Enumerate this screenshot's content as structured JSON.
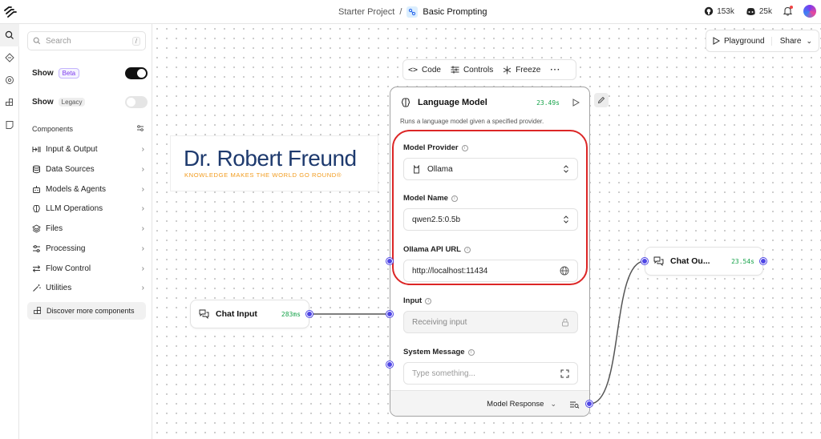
{
  "topbar": {
    "project": "Starter Project",
    "separator": "/",
    "flow_name": "Basic Prompting",
    "github_count": "153k",
    "discord_count": "25k"
  },
  "sidebar": {
    "search_placeholder": "Search",
    "search_shortcut": "/",
    "show_beta_label": "Show",
    "beta_badge": "Beta",
    "show_legacy_label": "Show",
    "legacy_badge": "Legacy",
    "components_heading": "Components",
    "categories": [
      {
        "label": "Input & Output",
        "icon": "input-output-icon"
      },
      {
        "label": "Data Sources",
        "icon": "database-icon"
      },
      {
        "label": "Models & Agents",
        "icon": "bot-icon"
      },
      {
        "label": "LLM Operations",
        "icon": "brain-icon"
      },
      {
        "label": "Files",
        "icon": "layers-icon"
      },
      {
        "label": "Processing",
        "icon": "sliders-icon"
      },
      {
        "label": "Flow Control",
        "icon": "arrows-icon"
      },
      {
        "label": "Utilities",
        "icon": "wand-icon"
      }
    ],
    "discover_label": "Discover more components"
  },
  "canvas": {
    "playground_label": "Playground",
    "share_label": "Share",
    "logo": {
      "name": "Dr. Robert Freund",
      "tagline": "KNOWLEDGE MAKES THE WORLD GO ROUND®"
    },
    "node_toolbar": {
      "code": "Code",
      "controls": "Controls",
      "freeze": "Freeze",
      "more": "···"
    },
    "language_model": {
      "title": "Language Model",
      "time": "23.49s",
      "description": "Runs a language model given a specified provider.",
      "provider_label": "Model Provider",
      "provider_value": "Ollama",
      "model_label": "Model Name",
      "model_value": "qwen2.5:0.5b",
      "url_label": "Ollama API URL",
      "url_value": "http://localhost:11434",
      "input_label": "Input",
      "input_placeholder": "Receiving input",
      "system_label": "System Message",
      "system_placeholder": "Type something...",
      "output_label": "Model Response"
    },
    "chat_input": {
      "label": "Chat Input",
      "time": "283ms"
    },
    "chat_output": {
      "label": "Chat Ou...",
      "time": "23.54s"
    }
  },
  "colors": {
    "accent": "#4f46e5",
    "highlight": "#dc2626",
    "time_green": "#16a34a",
    "logo_blue": "#1e3a6e",
    "logo_orange": "#f29b1d"
  }
}
